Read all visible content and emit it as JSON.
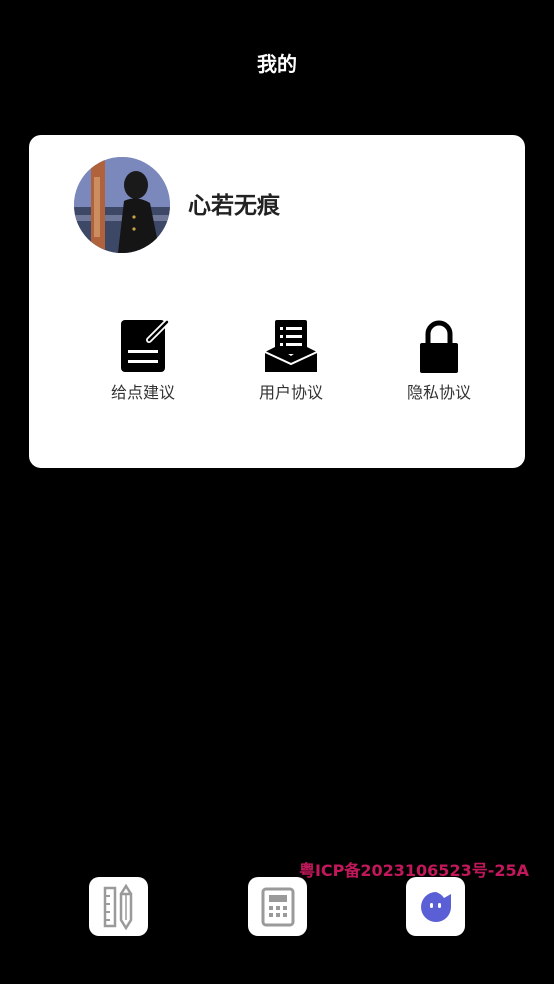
{
  "header": {
    "title": "我的"
  },
  "profile": {
    "username": "心若无痕",
    "avatar_icon": "user-photo-avatar"
  },
  "actions": [
    {
      "label": "给点建议",
      "icon": "edit-note-icon"
    },
    {
      "label": "用户协议",
      "icon": "document-tray-icon"
    },
    {
      "label": "隐私协议",
      "icon": "lock-icon"
    }
  ],
  "footer": {
    "icp": "粤ICP备2023106523号-25A",
    "icp_color": "#c2185b"
  },
  "tabbar": {
    "items": [
      {
        "icon": "ruler-pencil-icon"
      },
      {
        "icon": "calculator-icon"
      },
      {
        "icon": "profile-face-icon",
        "accent": "#5b5fd6"
      }
    ]
  }
}
